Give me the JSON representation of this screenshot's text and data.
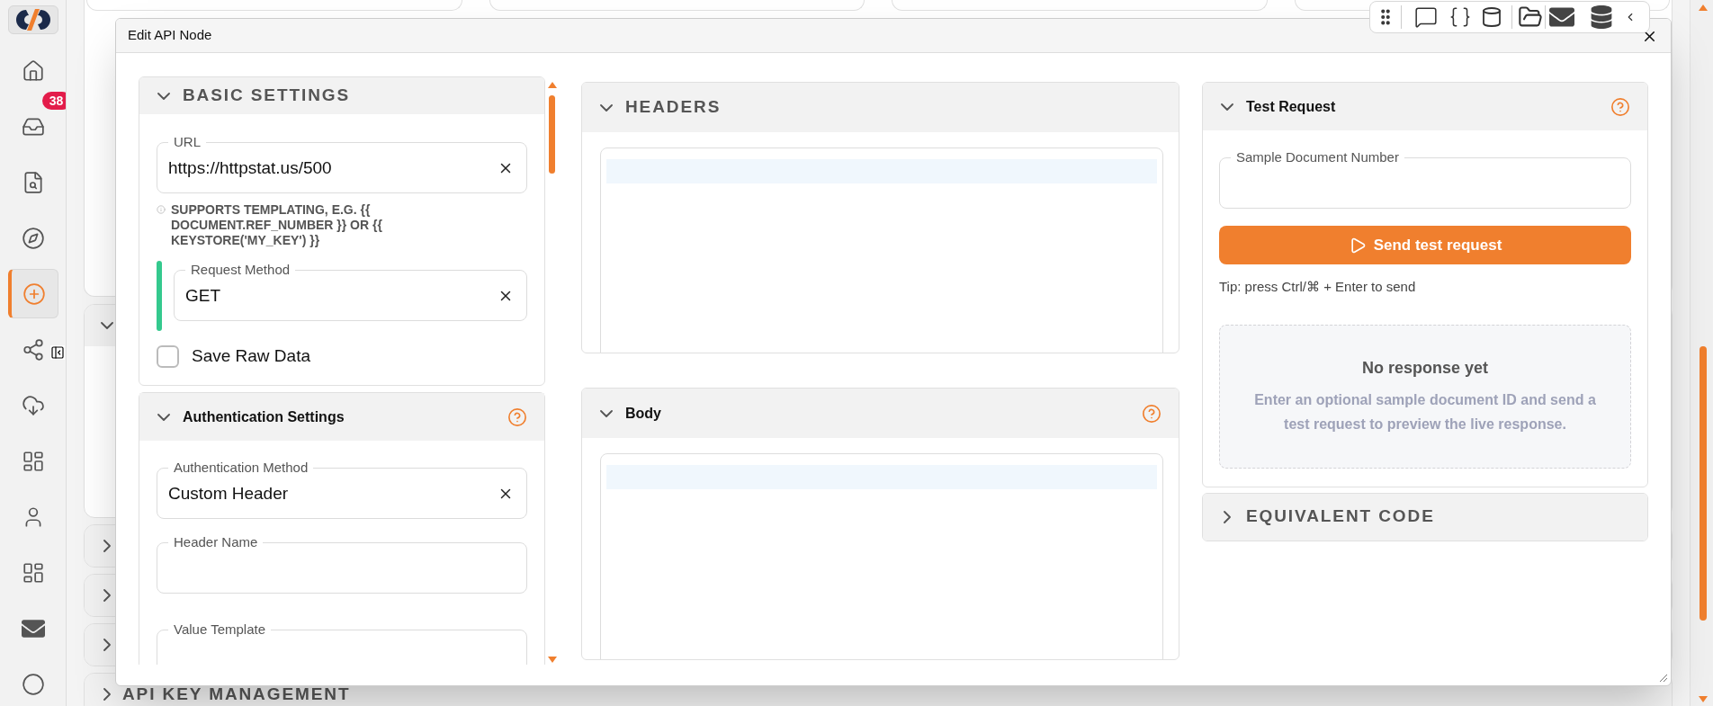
{
  "sidebar": {
    "items": [
      {
        "selected": false
      },
      {
        "selected": false,
        "badge": "38"
      },
      {
        "selected": false
      },
      {
        "selected": false
      },
      {
        "selected": true
      },
      {
        "selected": false
      },
      {
        "selected": false
      },
      {
        "selected": false
      },
      {
        "selected": false
      },
      {
        "selected": false
      },
      {
        "selected": false
      },
      {
        "selected": false
      }
    ]
  },
  "page": {
    "sections": [
      {
        "expanded": true
      },
      {
        "expanded": false
      },
      {
        "expanded": false
      },
      {
        "expanded": false
      },
      {
        "title": "API KEY MANAGEMENT",
        "expanded": false
      }
    ]
  },
  "dialog": {
    "title": "Edit API Node",
    "basic_settings": {
      "title": "BASIC SETTINGS",
      "expanded": true,
      "url": {
        "label": "URL",
        "value": "https://httpstat.us/500"
      },
      "hint": "SUPPORTS TEMPLATING, E.G. {{ DOCUMENT.REF_NUMBER }} OR {{ KEYSTORE('MY_KEY') }}",
      "request_method": {
        "label": "Request Method",
        "value": "GET"
      },
      "save_raw_data": {
        "label": "Save Raw Data",
        "checked": false
      }
    },
    "authentication_settings": {
      "title": "Authentication Settings",
      "expanded": true,
      "fields": [
        {
          "label": "Authentication Method",
          "value": "Custom Header"
        },
        {
          "label": "Header Name"
        },
        {
          "label": "Value Template"
        }
      ]
    },
    "headers": {
      "title": "HEADERS",
      "expanded": true
    },
    "body": {
      "title": "Body",
      "expanded": true
    },
    "test_request": {
      "title": "Test Request",
      "expanded": true,
      "sample_field": {
        "label": "Sample Document Number"
      },
      "send_button": "Send test request",
      "tip": "Tip: press Ctrl/⌘ + Enter to send",
      "empty_title": "No response yet",
      "empty_text": "Enter an optional sample document ID and send a test request to preview the live response."
    },
    "equivalent_code": {
      "title": "EQUIVALENT CODE",
      "expanded": false
    }
  }
}
